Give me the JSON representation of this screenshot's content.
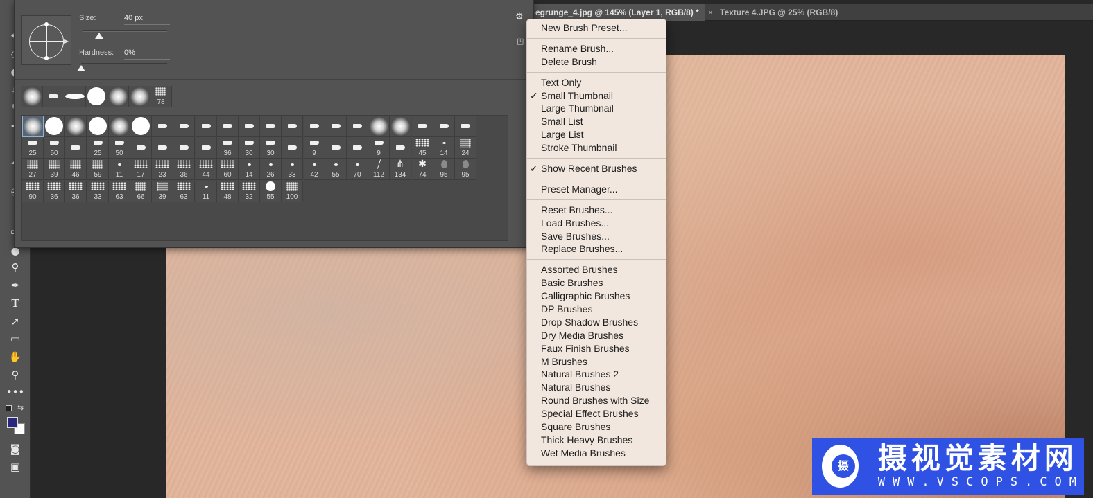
{
  "tabs": [
    {
      "label": "egrunge_4.jpg @ 145% (Layer 1, RGB/8) *",
      "active": true,
      "close": "×"
    },
    {
      "label": "Texture 4.JPG @ 25% (RGB/8)",
      "active": false,
      "close": "×"
    }
  ],
  "brush_panel": {
    "size_label": "Size:",
    "size_value": "40 px",
    "hardness_label": "Hardness:",
    "hardness_value": "0%",
    "size_slider_fraction": 0.2,
    "hardness_slider_fraction": 0.0,
    "recent_brushes": [
      {
        "kind": "soft",
        "num": ""
      },
      {
        "kind": "marker",
        "num": ""
      },
      {
        "kind": "ellipse",
        "num": ""
      },
      {
        "kind": "hard",
        "num": ""
      },
      {
        "kind": "soft",
        "num": ""
      },
      {
        "kind": "soft",
        "num": ""
      },
      {
        "kind": "speckle",
        "num": "78"
      }
    ],
    "preset_rows": [
      [
        {
          "kind": "soft",
          "num": ""
        },
        {
          "kind": "hard",
          "num": ""
        },
        {
          "kind": "soft",
          "num": ""
        },
        {
          "kind": "hard",
          "num": ""
        },
        {
          "kind": "soft",
          "num": ""
        },
        {
          "kind": "hard",
          "num": ""
        },
        {
          "kind": "marker",
          "num": ""
        },
        {
          "kind": "marker",
          "num": ""
        },
        {
          "kind": "marker",
          "num": ""
        },
        {
          "kind": "marker",
          "num": ""
        },
        {
          "kind": "marker",
          "num": ""
        },
        {
          "kind": "marker",
          "num": ""
        },
        {
          "kind": "marker",
          "num": ""
        },
        {
          "kind": "marker",
          "num": ""
        },
        {
          "kind": "marker",
          "num": ""
        },
        {
          "kind": "marker",
          "num": ""
        },
        {
          "kind": "soft",
          "num": ""
        },
        {
          "kind": "soft",
          "num": ""
        },
        {
          "kind": "marker",
          "num": ""
        },
        {
          "kind": "marker",
          "num": ""
        },
        {
          "kind": "marker",
          "num": ""
        }
      ],
      [
        {
          "kind": "marker",
          "num": "25"
        },
        {
          "kind": "marker",
          "num": "50"
        },
        {
          "kind": "marker",
          "num": ""
        },
        {
          "kind": "marker",
          "num": "25"
        },
        {
          "kind": "marker",
          "num": "50"
        },
        {
          "kind": "marker",
          "num": ""
        },
        {
          "kind": "marker",
          "num": ""
        },
        {
          "kind": "marker",
          "num": ""
        },
        {
          "kind": "marker",
          "num": ""
        },
        {
          "kind": "marker",
          "num": "36"
        },
        {
          "kind": "marker",
          "num": "30"
        },
        {
          "kind": "marker",
          "num": "30"
        },
        {
          "kind": "marker",
          "num": ""
        },
        {
          "kind": "marker",
          "num": "9"
        },
        {
          "kind": "marker",
          "num": ""
        },
        {
          "kind": "marker",
          "num": ""
        },
        {
          "kind": "marker",
          "num": "9"
        },
        {
          "kind": "marker",
          "num": ""
        },
        {
          "kind": "chalk",
          "num": "45"
        },
        {
          "kind": "small",
          "num": "14"
        },
        {
          "kind": "speckle",
          "num": "24"
        }
      ],
      [
        {
          "kind": "speckle",
          "num": "27"
        },
        {
          "kind": "speckle",
          "num": "39"
        },
        {
          "kind": "speckle",
          "num": "46"
        },
        {
          "kind": "speckle",
          "num": "59"
        },
        {
          "kind": "small",
          "num": "11"
        },
        {
          "kind": "chalk",
          "num": "17"
        },
        {
          "kind": "chalk",
          "num": "23"
        },
        {
          "kind": "chalk",
          "num": "36"
        },
        {
          "kind": "chalk",
          "num": "44"
        },
        {
          "kind": "chalk",
          "num": "60"
        },
        {
          "kind": "small",
          "num": "14"
        },
        {
          "kind": "small",
          "num": "26"
        },
        {
          "kind": "small",
          "num": "33"
        },
        {
          "kind": "small",
          "num": "42"
        },
        {
          "kind": "small",
          "num": "55"
        },
        {
          "kind": "small",
          "num": "70"
        },
        {
          "kind": "line",
          "num": "112"
        },
        {
          "kind": "grass",
          "num": "134"
        },
        {
          "kind": "leaf",
          "num": "74"
        },
        {
          "kind": "drop",
          "num": "95"
        },
        {
          "kind": "drop",
          "num": "95"
        }
      ],
      [
        {
          "kind": "chalk",
          "num": "90"
        },
        {
          "kind": "chalk",
          "num": "36"
        },
        {
          "kind": "chalk",
          "num": "36"
        },
        {
          "kind": "chalk",
          "num": "33"
        },
        {
          "kind": "chalk",
          "num": "63"
        },
        {
          "kind": "speckle",
          "num": "66"
        },
        {
          "kind": "speckle",
          "num": "39"
        },
        {
          "kind": "chalk",
          "num": "63"
        },
        {
          "kind": "small",
          "num": "11"
        },
        {
          "kind": "chalk",
          "num": "48"
        },
        {
          "kind": "chalk",
          "num": "32"
        },
        {
          "kind": "hard",
          "num": "55"
        },
        {
          "kind": "speckle",
          "num": "100"
        }
      ]
    ]
  },
  "menu": [
    {
      "label": "New Brush Preset..."
    },
    {
      "sep": true
    },
    {
      "label": "Rename Brush..."
    },
    {
      "label": "Delete Brush"
    },
    {
      "sep": true
    },
    {
      "label": "Text Only"
    },
    {
      "label": "Small Thumbnail",
      "checked": true
    },
    {
      "label": "Large Thumbnail"
    },
    {
      "label": "Small List"
    },
    {
      "label": "Large List"
    },
    {
      "label": "Stroke Thumbnail"
    },
    {
      "sep": true
    },
    {
      "label": "Show Recent Brushes",
      "checked": true
    },
    {
      "sep": true
    },
    {
      "label": "Preset Manager..."
    },
    {
      "sep": true
    },
    {
      "label": "Reset Brushes..."
    },
    {
      "label": "Load Brushes..."
    },
    {
      "label": "Save Brushes..."
    },
    {
      "label": "Replace Brushes..."
    },
    {
      "sep": true
    },
    {
      "label": "Assorted Brushes"
    },
    {
      "label": "Basic Brushes"
    },
    {
      "label": "Calligraphic Brushes"
    },
    {
      "label": "DP Brushes"
    },
    {
      "label": "Drop Shadow Brushes"
    },
    {
      "label": "Dry Media Brushes"
    },
    {
      "label": "Faux Finish Brushes"
    },
    {
      "label": "M Brushes"
    },
    {
      "label": "Natural Brushes 2"
    },
    {
      "label": "Natural Brushes"
    },
    {
      "label": "Round Brushes with Size"
    },
    {
      "label": "Special Effect Brushes"
    },
    {
      "label": "Square Brushes"
    },
    {
      "label": "Thick Heavy Brushes"
    },
    {
      "label": "Wet Media Brushes"
    }
  ],
  "watermark": {
    "logo_char": "摄",
    "title": "摄视觉素材网",
    "url": "WWW.VSCOPS.COM"
  },
  "colors": {
    "foreground": "#29287d",
    "background": "#ffffff",
    "watermark_bg": "#2f52e5"
  }
}
